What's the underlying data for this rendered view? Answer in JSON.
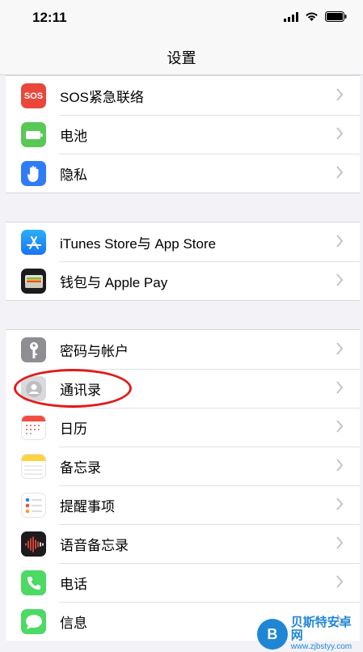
{
  "status_bar": {
    "time": "12:11"
  },
  "nav": {
    "title": "设置"
  },
  "groups": [
    [
      {
        "label": "SOS紧急联络",
        "icon": "sos-icon",
        "icon_text": "SOS",
        "color": "#e9473b"
      },
      {
        "label": "电池",
        "icon": "battery-icon",
        "color": "#5ac857"
      },
      {
        "label": "隐私",
        "icon": "hand-icon",
        "color": "#2f7cf6"
      }
    ],
    [
      {
        "label": "iTunes Store与 App Store",
        "icon": "app-store-icon",
        "color": "#1f8cf5"
      },
      {
        "label": "钱包与 Apple Pay",
        "icon": "wallet-icon",
        "color": "#1c1c1e"
      }
    ],
    [
      {
        "label": "密码与帐户",
        "icon": "key-icon",
        "color": "#8e8e93"
      },
      {
        "label": "通讯录",
        "icon": "contacts-icon",
        "color": "#c9c9ce"
      },
      {
        "label": "日历",
        "icon": "calendar-icon",
        "color": "#ffffff"
      },
      {
        "label": "备忘录",
        "icon": "notes-icon",
        "color": "#ffffff"
      },
      {
        "label": "提醒事项",
        "icon": "reminders-icon",
        "color": "#ffffff"
      },
      {
        "label": "语音备忘录",
        "icon": "voice-memos-icon",
        "color": "#1c1c1e"
      },
      {
        "label": "电话",
        "icon": "phone-icon",
        "color": "#4cd964"
      },
      {
        "label": "信息",
        "icon": "messages-icon",
        "color": "#4cd964"
      }
    ]
  ],
  "highlight_color": "#e01b1b",
  "watermark": {
    "line1": "贝斯特安卓网",
    "line2": "www.zjbstyy.com"
  }
}
